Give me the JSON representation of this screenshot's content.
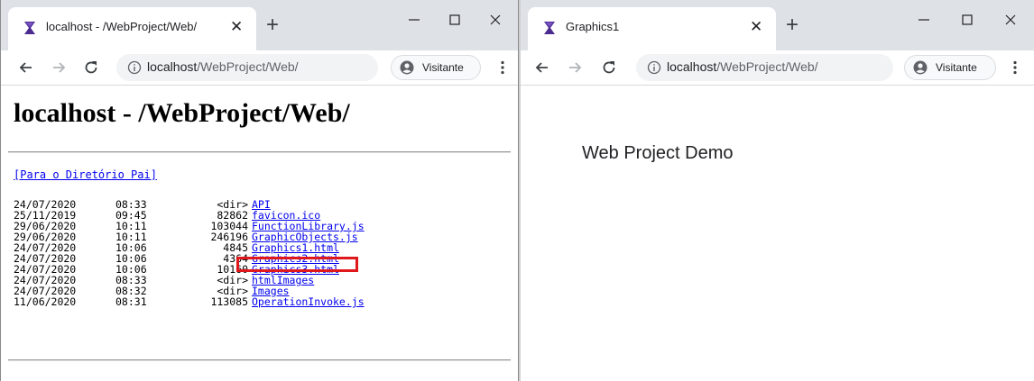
{
  "left_window": {
    "tab_title": "localhost - /WebProject/Web/",
    "url_host": "localhost",
    "url_path": "/WebProject/Web/",
    "profile_label": "Visitante",
    "heading": "localhost - /WebProject/Web/",
    "parent_link": "[Para o Diretório Pai]",
    "highlight_color": "#e0181b",
    "entries": [
      {
        "date": "24/07/2020",
        "time": "08:33",
        "size": "<dir>",
        "name": "API"
      },
      {
        "date": "25/11/2019",
        "time": "09:45",
        "size": "82862",
        "name": "favicon.ico"
      },
      {
        "date": "29/06/2020",
        "time": "10:11",
        "size": "103044",
        "name": "FunctionLibrary.js"
      },
      {
        "date": "29/06/2020",
        "time": "10:11",
        "size": "246196",
        "name": "GraphicObjects.js"
      },
      {
        "date": "24/07/2020",
        "time": "10:06",
        "size": "4845",
        "name": "Graphics1.html"
      },
      {
        "date": "24/07/2020",
        "time": "10:06",
        "size": "4364",
        "name": "Graphics2.html"
      },
      {
        "date": "24/07/2020",
        "time": "10:06",
        "size": "10160",
        "name": "Graphics3.html"
      },
      {
        "date": "24/07/2020",
        "time": "08:33",
        "size": "<dir>",
        "name": "htmlImages"
      },
      {
        "date": "24/07/2020",
        "time": "08:32",
        "size": "<dir>",
        "name": "Images"
      },
      {
        "date": "11/06/2020",
        "time": "08:31",
        "size": "113085",
        "name": "OperationInvoke.js"
      }
    ]
  },
  "right_window": {
    "tab_title": "Graphics1",
    "url_host": "localhost",
    "url_path": "/WebProject/Web/",
    "profile_label": "Visitante",
    "page_text": "Web Project Demo"
  },
  "icons": {
    "favicon": "purple-hourglass-icon",
    "close": "close-icon",
    "new_tab": "plus-icon",
    "minimize": "minimize-icon",
    "maximize": "maximize-icon",
    "back": "arrow-left-icon",
    "forward": "arrow-right-icon",
    "reload": "reload-icon",
    "site_info": "info-icon",
    "profile": "person-icon",
    "menu": "three-dots-icon"
  }
}
